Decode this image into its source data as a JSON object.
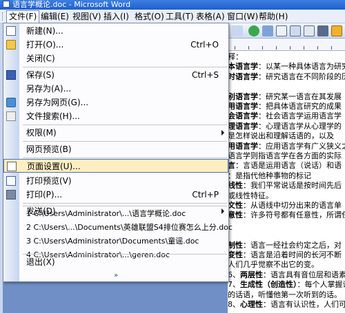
{
  "window": {
    "title": "语言学概论.doc - Microsoft Word"
  },
  "menubar": {
    "items": [
      {
        "label": "文件(F)"
      },
      {
        "label": "编辑(E)"
      },
      {
        "label": "视图(V)"
      },
      {
        "label": "插入(I)"
      },
      {
        "label": "格式(O)"
      },
      {
        "label": "工具(T)"
      },
      {
        "label": "表格(A)"
      },
      {
        "label": "窗口(W)"
      },
      {
        "label": "帮助(H)"
      }
    ]
  },
  "file_menu": {
    "new": {
      "label": "新建(N)..."
    },
    "open": {
      "label": "打开(O)...",
      "shortcut": "Ctrl+O"
    },
    "close": {
      "label": "关闭(C)"
    },
    "save": {
      "label": "保存(S)",
      "shortcut": "Ctrl+S"
    },
    "save_as": {
      "label": "另存为(A)..."
    },
    "save_web": {
      "label": "另存为网页(G)..."
    },
    "search": {
      "label": "文件搜索(H)..."
    },
    "permission": {
      "label": "权限(M)"
    },
    "web_preview": {
      "label": "网页预览(B)"
    },
    "page_setup": {
      "label": "页面设置(U)..."
    },
    "print_preview": {
      "label": "打印预览(V)"
    },
    "print": {
      "label": "打印(P)...",
      "shortcut": "Ctrl+P"
    },
    "send_to": {
      "label": "发送(D)"
    },
    "recent": [
      {
        "label": "1 C:\\Users\\Administrator\\...\\语言学概论.doc"
      },
      {
        "label": "2 C:\\Users\\...\\Documents\\英雄联盟S4排位赛怎么上分.doc"
      },
      {
        "label": "3 C:\\Users\\Administrator\\Documents\\童谣.doc"
      },
      {
        "label": "4 C:\\Users\\Administrator\\...\\geren.doc"
      }
    ],
    "exit": {
      "label": "退出(X)"
    },
    "expand_glyph": "»"
  },
  "document": {
    "lines": [
      {
        "text": "释："
      },
      {
        "key": "本语言学",
        "text": "：以某一种具体语言为研究"
      },
      {
        "key": "时语言学",
        "text": "：研究语言在不同阶段的历"
      },
      {
        "text": ""
      },
      {
        "key": "别语言学",
        "text": "：研究某一语言在其发展"
      },
      {
        "key": "用语言学",
        "text": "：把具体语言研究的成果"
      },
      {
        "key": "会语言学",
        "text": "：社会语言学运用语言学"
      },
      {
        "key": "理语言学",
        "text": "：心理语言学从心理学的"
      },
      {
        "text": "是怎样说出和理解话语的，以及"
      },
      {
        "key": "用语言学",
        "text": "：应用语言学有广义狭义之"
      },
      {
        "text": "语言学则指语言学在各方面的实际"
      },
      {
        "key": "言",
        "text": "：言语是运用语言（说话）和语"
      },
      {
        "text": "：是指代他种事物的标记"
      },
      {
        "key": "线性",
        "text": "：我们平常说话是按时间先后"
      },
      {
        "text": "或线性特征。"
      },
      {
        "key": "文性",
        "text": "：从语线中切分出来的语言单"
      },
      {
        "key": "意性",
        "text": "：许多符号都有任意性，所谓任"
      },
      {
        "text": ""
      },
      {
        "text": ""
      },
      {
        "key": "制性",
        "text": "：语言一经社会约定之后，对"
      },
      {
        "key": "变性",
        "text": "：语言是沿着时间的长河不断"
      },
      {
        "text": "人们几乎觉察不出它的变。"
      },
      {
        "num": "6、",
        "key": "两层性",
        "text": "：语言具有音位层和语素层，这"
      },
      {
        "num": "7、",
        "key": "生成性（创造性）",
        "text": "：每个人掌握语言都"
      },
      {
        "text": "的话语，听懂他第一次听到的话。"
      },
      {
        "num": "8、",
        "key": "心理性",
        "text": "：语言有认识性，人们可以借"
      }
    ]
  }
}
